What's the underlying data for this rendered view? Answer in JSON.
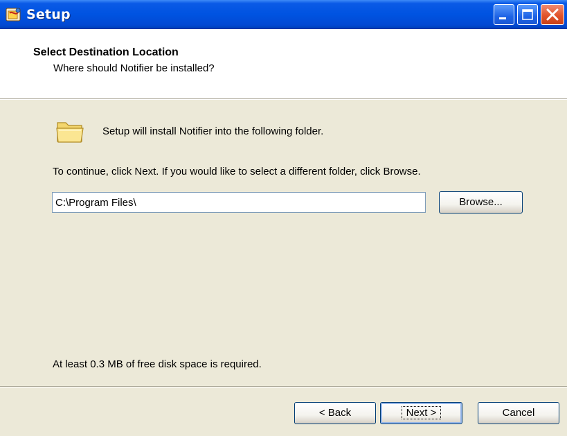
{
  "window": {
    "title": "Setup",
    "app_icon": "setup-package-icon",
    "controls": {
      "minimize": "minimize-icon",
      "maximize": "maximize-icon",
      "close": "close-icon"
    }
  },
  "header": {
    "title": "Select Destination Location",
    "subtitle": "Where should Notifier be installed?"
  },
  "main": {
    "folder_icon": "folder-icon",
    "intro": "Setup will install Notifier into the following folder.",
    "instruction": "To continue, click Next. If you would like to select a different folder, click Browse.",
    "path_value": "C:\\Program Files\\",
    "browse_label": "Browse...",
    "disk_space": "At least 0.3 MB of free disk space is required."
  },
  "footer": {
    "back_label": "< Back",
    "next_label": "Next >",
    "cancel_label": "Cancel"
  },
  "colors": {
    "titlebar": "#0053e1",
    "dialog_background": "#ece9d8",
    "header_background": "#ffffff",
    "button_border": "#003c74",
    "close_button": "#e2542b"
  }
}
